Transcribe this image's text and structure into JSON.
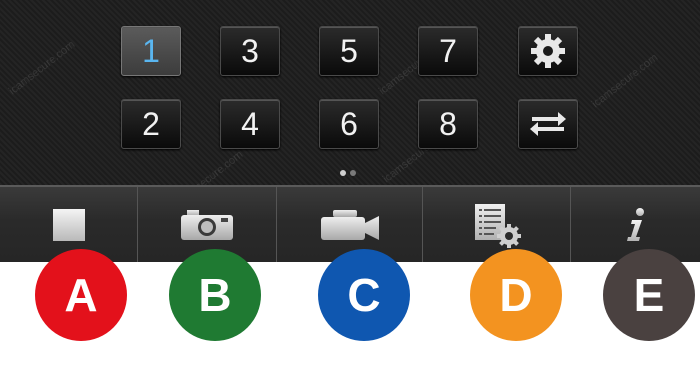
{
  "grid": {
    "keys": [
      {
        "label": "1",
        "active": true
      },
      {
        "label": "3",
        "active": false
      },
      {
        "label": "5",
        "active": false
      },
      {
        "label": "7",
        "active": false
      },
      {
        "label": "2",
        "active": false
      },
      {
        "label": "4",
        "active": false
      },
      {
        "label": "6",
        "active": false
      },
      {
        "label": "8",
        "active": false
      }
    ],
    "settings_icon": "gear-icon",
    "swap_icon": "swap-arrows-icon"
  },
  "pager": {
    "pages": 2,
    "current": 1
  },
  "toolbar": {
    "items": [
      {
        "name": "stop",
        "icon": "stop-square-icon"
      },
      {
        "name": "snapshot",
        "icon": "camera-icon"
      },
      {
        "name": "record",
        "icon": "video-camera-icon"
      },
      {
        "name": "settings-list",
        "icon": "list-settings-icon"
      },
      {
        "name": "info",
        "icon": "info-icon"
      }
    ]
  },
  "badges": [
    {
      "letter": "A",
      "color": "#e3111b"
    },
    {
      "letter": "B",
      "color": "#1f7a32"
    },
    {
      "letter": "C",
      "color": "#0f57b0"
    },
    {
      "letter": "D",
      "color": "#f39320"
    },
    {
      "letter": "E",
      "color": "#4a4140"
    }
  ],
  "watermark": "icamsecure.com",
  "colors": {
    "active_key_text": "#5ab6f0"
  }
}
